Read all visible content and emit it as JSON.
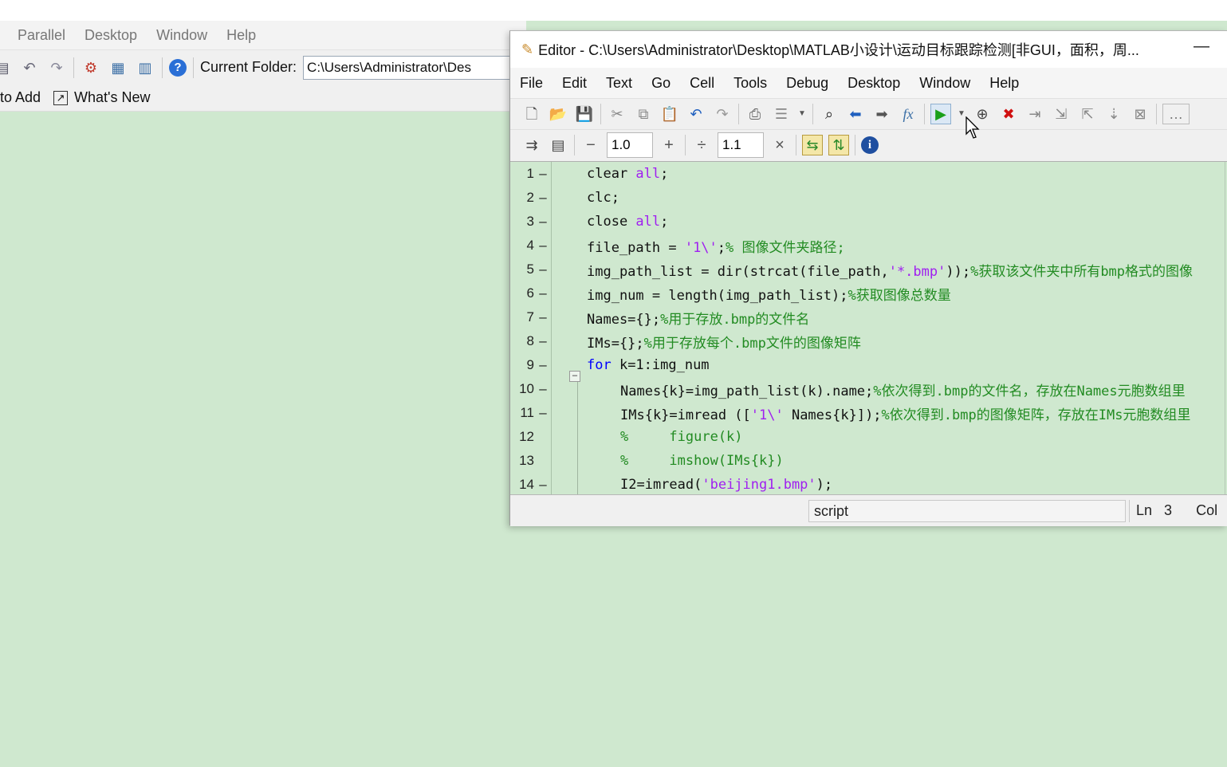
{
  "desktop": {
    "menu": [
      "Parallel",
      "Desktop",
      "Window",
      "Help"
    ],
    "current_folder_label": "Current Folder:",
    "current_folder_value": "C:\\Users\\Administrator\\Des",
    "shortcuts": [
      "to Add",
      "What's New"
    ]
  },
  "editor": {
    "title": "Editor - C:\\Users\\Administrator\\Desktop\\MATLAB小设计\\运动目标跟踪检测[非GUI，面积，周...",
    "minimize": "—",
    "menu": [
      "File",
      "Edit",
      "Text",
      "Go",
      "Cell",
      "Tools",
      "Debug",
      "Desktop",
      "Window",
      "Help"
    ],
    "cell_values": [
      "1.0",
      "1.1"
    ],
    "code_lines": [
      {
        "n": "1",
        "bp": "–",
        "indent": 0,
        "parts": [
          [
            "code",
            "clear "
          ],
          [
            "str",
            "all"
          ],
          [
            "code",
            ";"
          ]
        ]
      },
      {
        "n": "2",
        "bp": "–",
        "indent": 0,
        "parts": [
          [
            "code",
            "clc;"
          ]
        ]
      },
      {
        "n": "3",
        "bp": "–",
        "indent": 0,
        "parts": [
          [
            "code",
            "close "
          ],
          [
            "str",
            "all"
          ],
          [
            "code",
            ";"
          ]
        ]
      },
      {
        "n": "4",
        "bp": "–",
        "indent": 0,
        "parts": [
          [
            "code",
            "file_path = "
          ],
          [
            "str",
            "'1\\'"
          ],
          [
            "code",
            ";"
          ],
          [
            "cmt",
            "% 图像文件夹路径;"
          ]
        ]
      },
      {
        "n": "5",
        "bp": "–",
        "indent": 0,
        "parts": [
          [
            "code",
            "img_path_list = dir(strcat(file_path,"
          ],
          [
            "str",
            "'*.bmp'"
          ],
          [
            "code",
            "));"
          ],
          [
            "cmt",
            "%获取该文件夹中所有bmp格式的图像"
          ]
        ]
      },
      {
        "n": "6",
        "bp": "–",
        "indent": 0,
        "parts": [
          [
            "code",
            "img_num = length(img_path_list);"
          ],
          [
            "cmt",
            "%获取图像总数量"
          ]
        ]
      },
      {
        "n": "7",
        "bp": "–",
        "indent": 0,
        "parts": [
          [
            "code",
            "Names={};"
          ],
          [
            "cmt",
            "%用于存放.bmp的文件名"
          ]
        ]
      },
      {
        "n": "8",
        "bp": "–",
        "indent": 0,
        "parts": [
          [
            "code",
            "IMs={};"
          ],
          [
            "cmt",
            "%用于存放每个.bmp文件的图像矩阵"
          ]
        ]
      },
      {
        "n": "9",
        "bp": "–",
        "indent": 0,
        "fold": "−",
        "parts": [
          [
            "kw",
            "for "
          ],
          [
            "code",
            "k=1:img_num"
          ]
        ]
      },
      {
        "n": "10",
        "bp": "–",
        "indent": 1,
        "parts": [
          [
            "code",
            "Names{k}=img_path_list(k).name;"
          ],
          [
            "cmt",
            "%依次得到.bmp的文件名，存放在Names元胞数组里"
          ]
        ]
      },
      {
        "n": "11",
        "bp": "–",
        "indent": 1,
        "parts": [
          [
            "code",
            "IMs{k}=imread (["
          ],
          [
            "str",
            "'1\\'"
          ],
          [
            "code",
            " Names{k}]);"
          ],
          [
            "cmt",
            "%依次得到.bmp的图像矩阵，存放在IMs元胞数组里"
          ]
        ]
      },
      {
        "n": "12",
        "bp": "",
        "indent": 1,
        "parts": [
          [
            "cmt",
            "%     figure(k)"
          ]
        ]
      },
      {
        "n": "13",
        "bp": "",
        "indent": 1,
        "parts": [
          [
            "cmt",
            "%     imshow(IMs{k})"
          ]
        ]
      },
      {
        "n": "14",
        "bp": "–",
        "indent": 1,
        "parts": [
          [
            "code",
            "I2=imread("
          ],
          [
            "str",
            "'beijing1.bmp'"
          ],
          [
            "code",
            ");"
          ]
        ]
      }
    ],
    "status": {
      "script": "script",
      "ln_label": "Ln",
      "ln_value": "3",
      "col_label": "Col"
    }
  }
}
